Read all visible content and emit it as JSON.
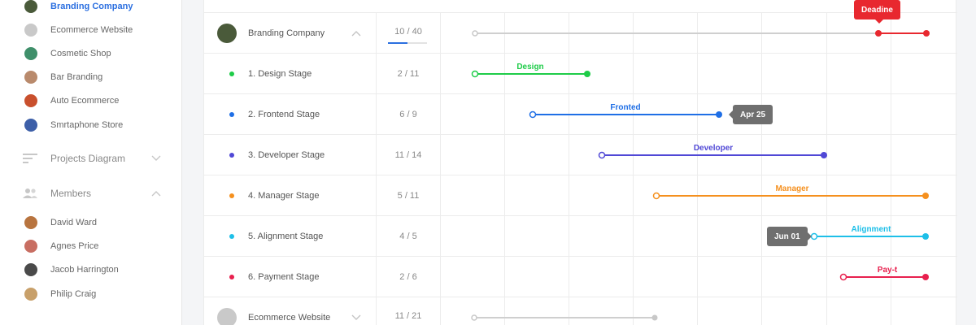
{
  "sidebar": {
    "projects": [
      {
        "label": "Branding Company",
        "active": true,
        "avatar_color": "#4a5a3a"
      },
      {
        "label": "Ecommerce Website",
        "active": false,
        "avatar_color": "#c9c9c9"
      },
      {
        "label": "Cosmetic Shop",
        "active": false,
        "avatar_color": "#3f8f6a"
      },
      {
        "label": "Bar Branding",
        "active": false,
        "avatar_color": "#b98a6c"
      },
      {
        "label": "Auto Ecommerce",
        "active": false,
        "avatar_color": "#c9502d"
      },
      {
        "label": "Smrtaphone Store",
        "active": false,
        "avatar_color": "#3d5fa8"
      }
    ],
    "projects_diagram_label": "Projects Diagram",
    "members_label": "Members",
    "members": [
      {
        "name": "David Ward",
        "avatar_color": "#b8743f"
      },
      {
        "name": "Agnes Price",
        "avatar_color": "#c86e62"
      },
      {
        "name": "Jacob Harrington",
        "avatar_color": "#4a4a4a"
      },
      {
        "name": "Philip Craig",
        "avatar_color": "#c8a06a"
      }
    ]
  },
  "gantt": {
    "rows": [
      {
        "type": "group",
        "name": "Branding Company",
        "count": "10 / 40",
        "progress": 0.5,
        "avatar_color": "#4a5a3a",
        "chevron": "up"
      },
      {
        "type": "stage",
        "name": "1. Design Stage",
        "count": "2 / 11",
        "color": "#1ecc48"
      },
      {
        "type": "stage",
        "name": "2. Frontend Stage",
        "count": "6 / 9",
        "color": "#1f6fe6"
      },
      {
        "type": "stage",
        "name": "3. Developer Stage",
        "count": "11 / 14",
        "color": "#5048d6"
      },
      {
        "type": "stage",
        "name": "4. Manager Stage",
        "count": "5 / 11",
        "color": "#f5901e"
      },
      {
        "type": "stage",
        "name": "5. Alignment Stage",
        "count": "4 / 5",
        "color": "#1ebfe8"
      },
      {
        "type": "stage",
        "name": "6. Payment Stage",
        "count": "2 / 6",
        "color": "#e8204e"
      },
      {
        "type": "group",
        "name": "Ecommerce Website",
        "count": "11 / 21",
        "avatar_color": "#c9c9c9",
        "chevron": "down"
      }
    ],
    "bar_labels": [
      "Design",
      "Fronted",
      "Developer",
      "Manager",
      "Alignment",
      "Pay-t"
    ],
    "tooltips": {
      "deadline": "Deadine",
      "frontend_end": "Apr 25",
      "alignment_start": "Jun 01"
    },
    "colors": {
      "deadline": "#e8282f",
      "neutral": "#c8c8c8",
      "accent": "#2b6fe0"
    }
  }
}
